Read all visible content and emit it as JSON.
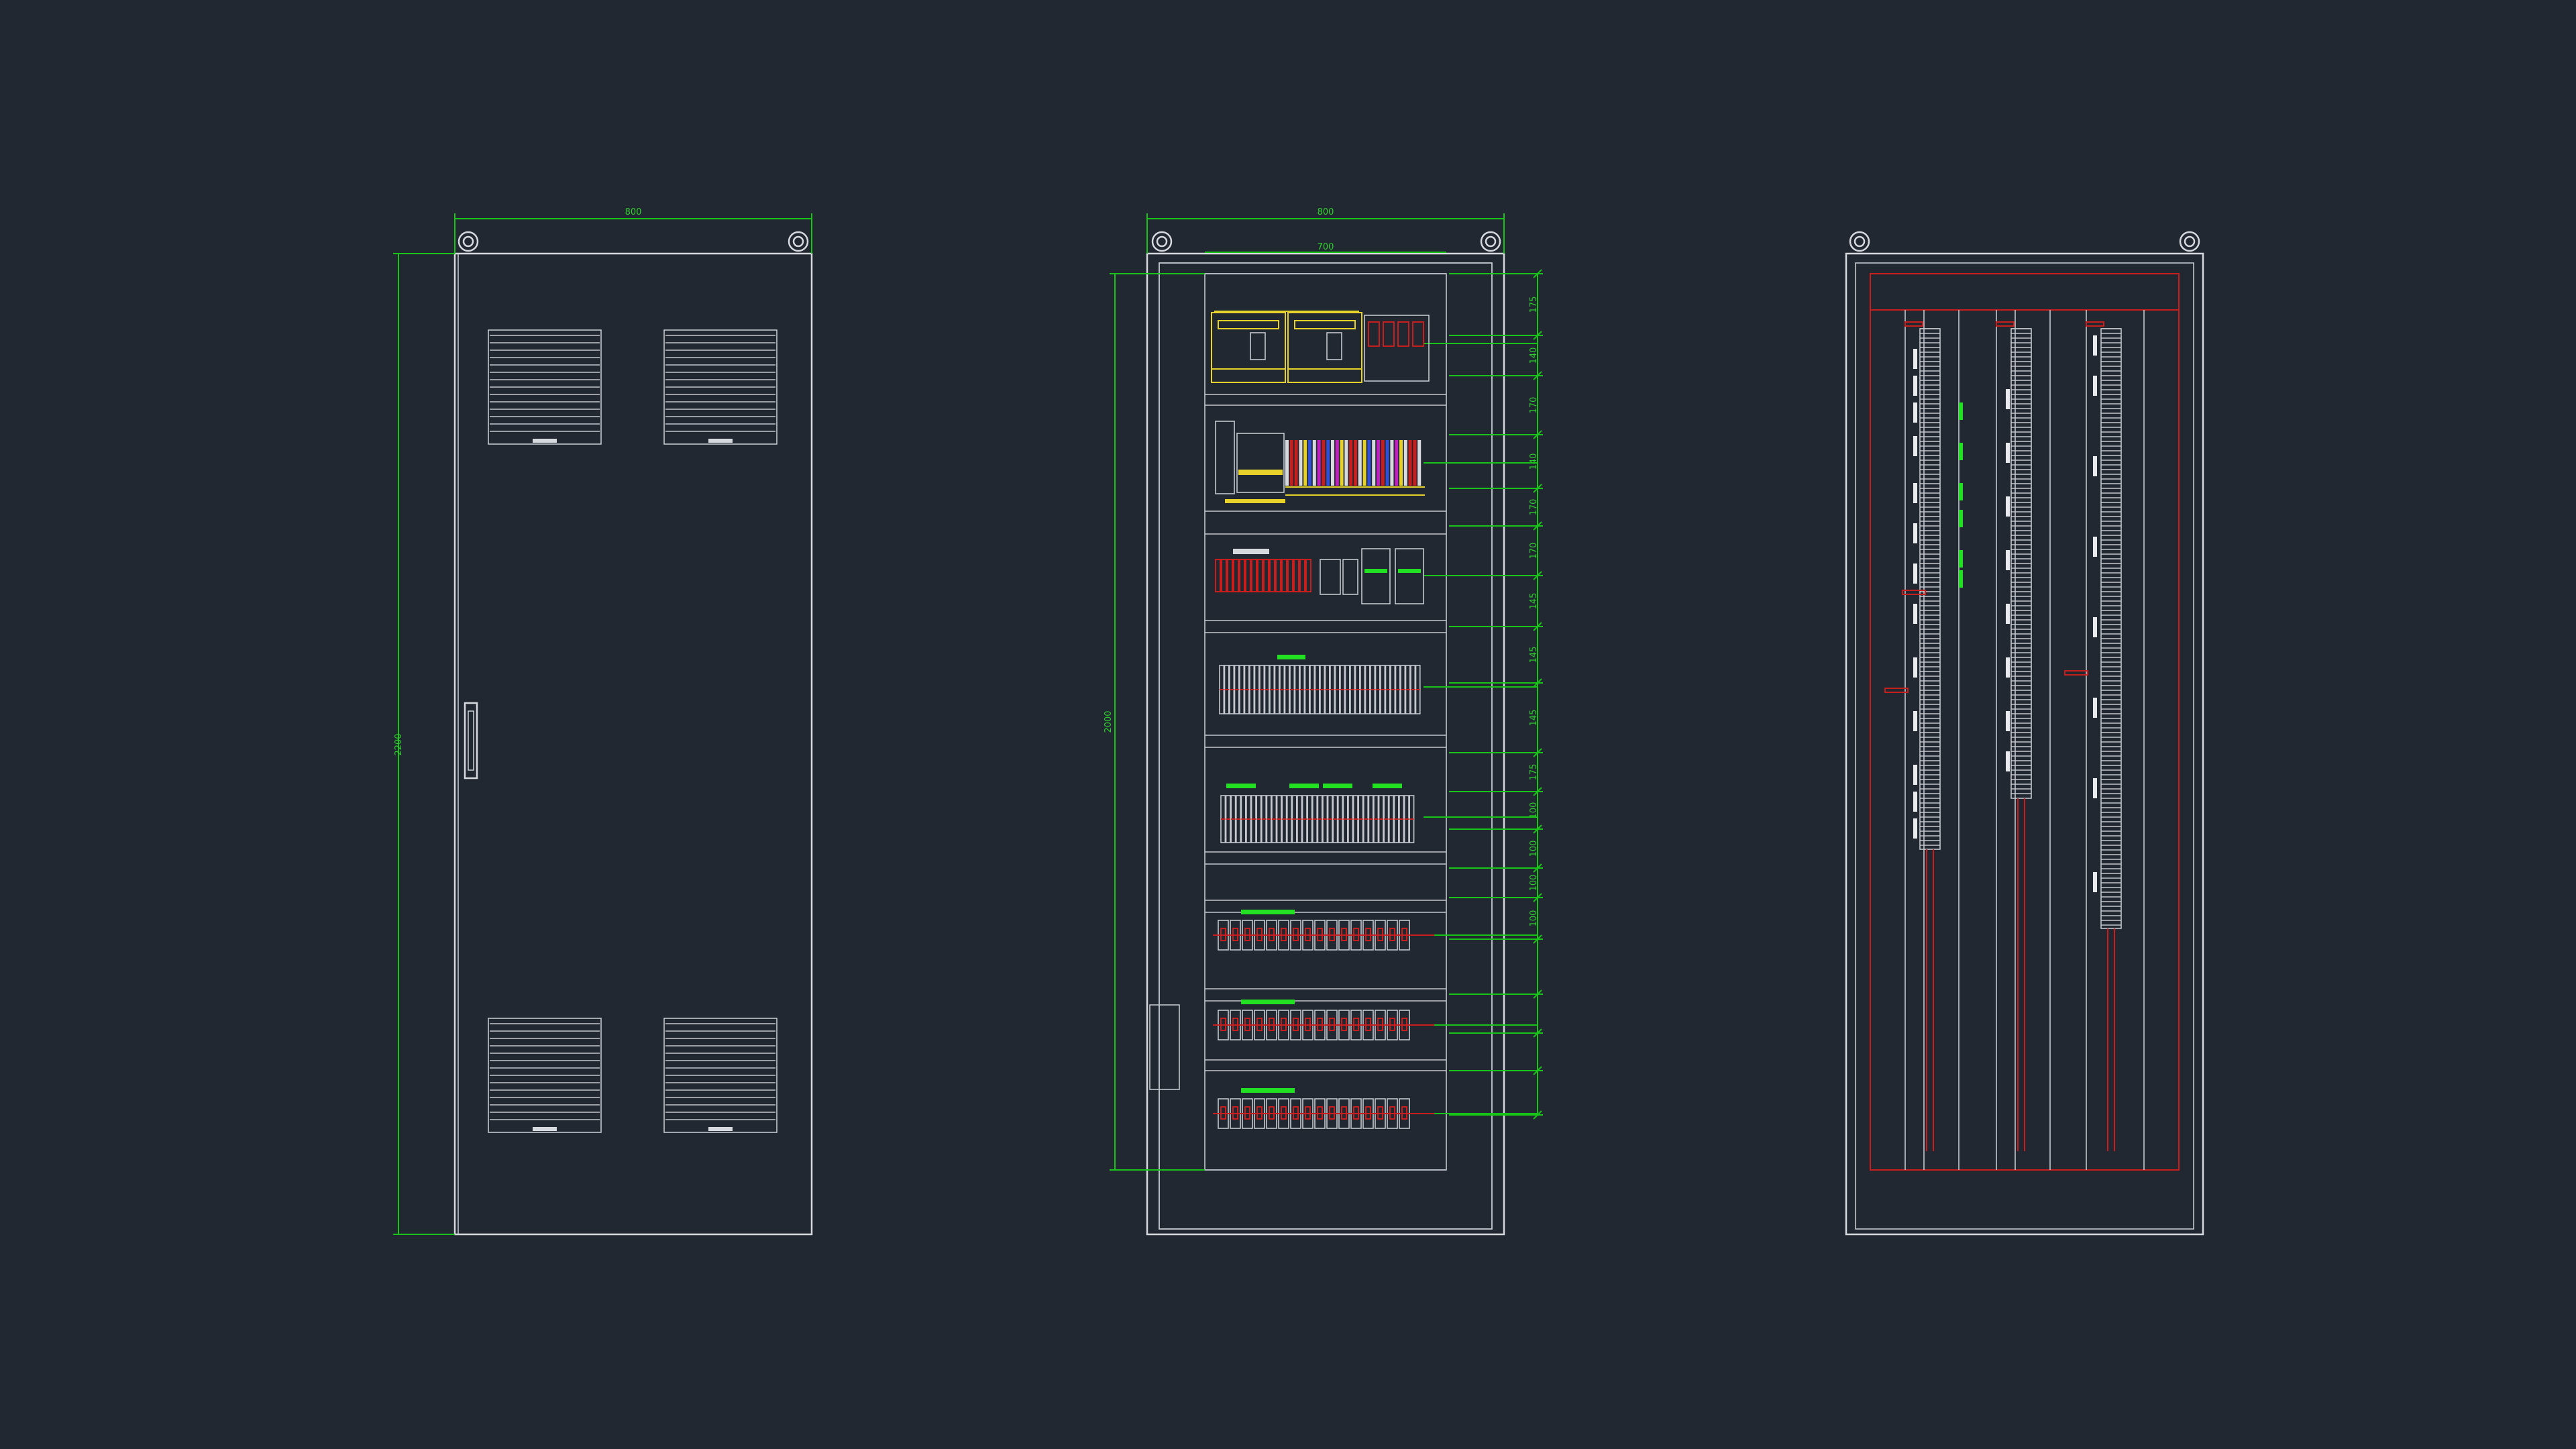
{
  "drawing": {
    "background": "#222831",
    "colors": {
      "outline": "#d6d9de",
      "dimension": "#19c419",
      "wiring": "#c81e1e",
      "component_yellow": "#e6d22a",
      "label_green": "#22e022"
    },
    "front_view": {
      "width_dim": "800",
      "height_dim": "2200",
      "louvers": 4,
      "handle": "door-handle"
    },
    "inner_view": {
      "width_dim": "800",
      "inner_width_dim": "700",
      "height_dim": "2000",
      "row_dims": [
        "175",
        "140",
        "170",
        "140",
        "170",
        "170",
        "145",
        "145",
        "145",
        "175",
        "100",
        "100",
        "100",
        "100"
      ],
      "rows": 8
    },
    "side_view": {
      "rails": 3
    }
  }
}
